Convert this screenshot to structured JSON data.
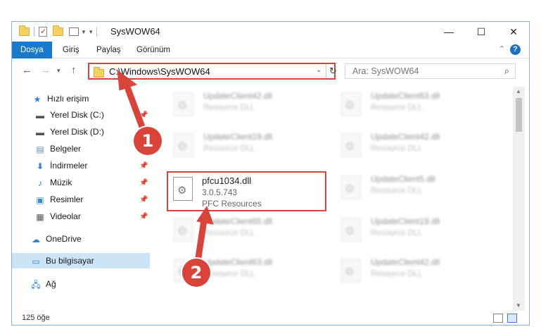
{
  "window": {
    "title": "SysWOW64",
    "controls": {
      "minimize": "—",
      "maximize": "☐",
      "close": "✕"
    }
  },
  "ribbon": {
    "tabs": [
      {
        "label": "Dosya",
        "active": true
      },
      {
        "label": "Giriş",
        "active": false
      },
      {
        "label": "Paylaş",
        "active": false
      },
      {
        "label": "Görünüm",
        "active": false
      }
    ],
    "help": "?"
  },
  "address": {
    "path": "C:\\Windows\\SysWOW64",
    "search_placeholder": "Ara: SysWOW64"
  },
  "nav": {
    "items": [
      {
        "label": "Hızlı erişim",
        "icon": "star-icon",
        "pinned": false
      },
      {
        "label": "Yerel Disk (C:)",
        "icon": "drive-icon",
        "pinned": true
      },
      {
        "label": "Yerel Disk (D:)",
        "icon": "drive-icon",
        "pinned": false
      },
      {
        "label": "Belgeler",
        "icon": "documents-icon",
        "pinned": true
      },
      {
        "label": "İndirmeler",
        "icon": "download-icon",
        "pinned": true
      },
      {
        "label": "Müzik",
        "icon": "music-icon",
        "pinned": true
      },
      {
        "label": "Resimler",
        "icon": "pictures-icon",
        "pinned": true
      },
      {
        "label": "Videolar",
        "icon": "videos-icon",
        "pinned": true
      },
      {
        "label": "OneDrive",
        "icon": "cloud-icon",
        "pinned": false
      },
      {
        "label": "Bu bilgisayar",
        "icon": "computer-icon",
        "pinned": false,
        "selected": true
      },
      {
        "label": "Ağ",
        "icon": "network-icon",
        "pinned": false
      }
    ]
  },
  "files": {
    "left": [
      {
        "name": "UpdateClient42.dll",
        "desc": "Resource DLL"
      },
      {
        "name": "UpdateClient19.dll",
        "desc": "Resource DLL"
      },
      {
        "name": "UpdateClient65.dll",
        "desc": "Resource DLL"
      },
      {
        "name": "UpdateClient63.dll",
        "desc": "Resource DLL"
      }
    ],
    "right": [
      {
        "name": "UpdateClient63.dll",
        "desc": "Resource DLL"
      },
      {
        "name": "UpdateClient42.dll",
        "desc": "Resource DLL"
      },
      {
        "name": "UpdateClient5.dll",
        "desc": "Resource DLL"
      },
      {
        "name": "UpdateClient19.dll",
        "desc": "Resource DLL"
      },
      {
        "name": "UpdateClient42.dll",
        "desc": "Resource DLL"
      }
    ],
    "highlighted": {
      "name": "pfcu1034.dll",
      "version": "3.0.5.743",
      "desc": "PFC Resources"
    }
  },
  "status": {
    "count": "125 öğe"
  },
  "annotations": {
    "step1": "1",
    "step2": "2",
    "color": "#d9443a"
  }
}
